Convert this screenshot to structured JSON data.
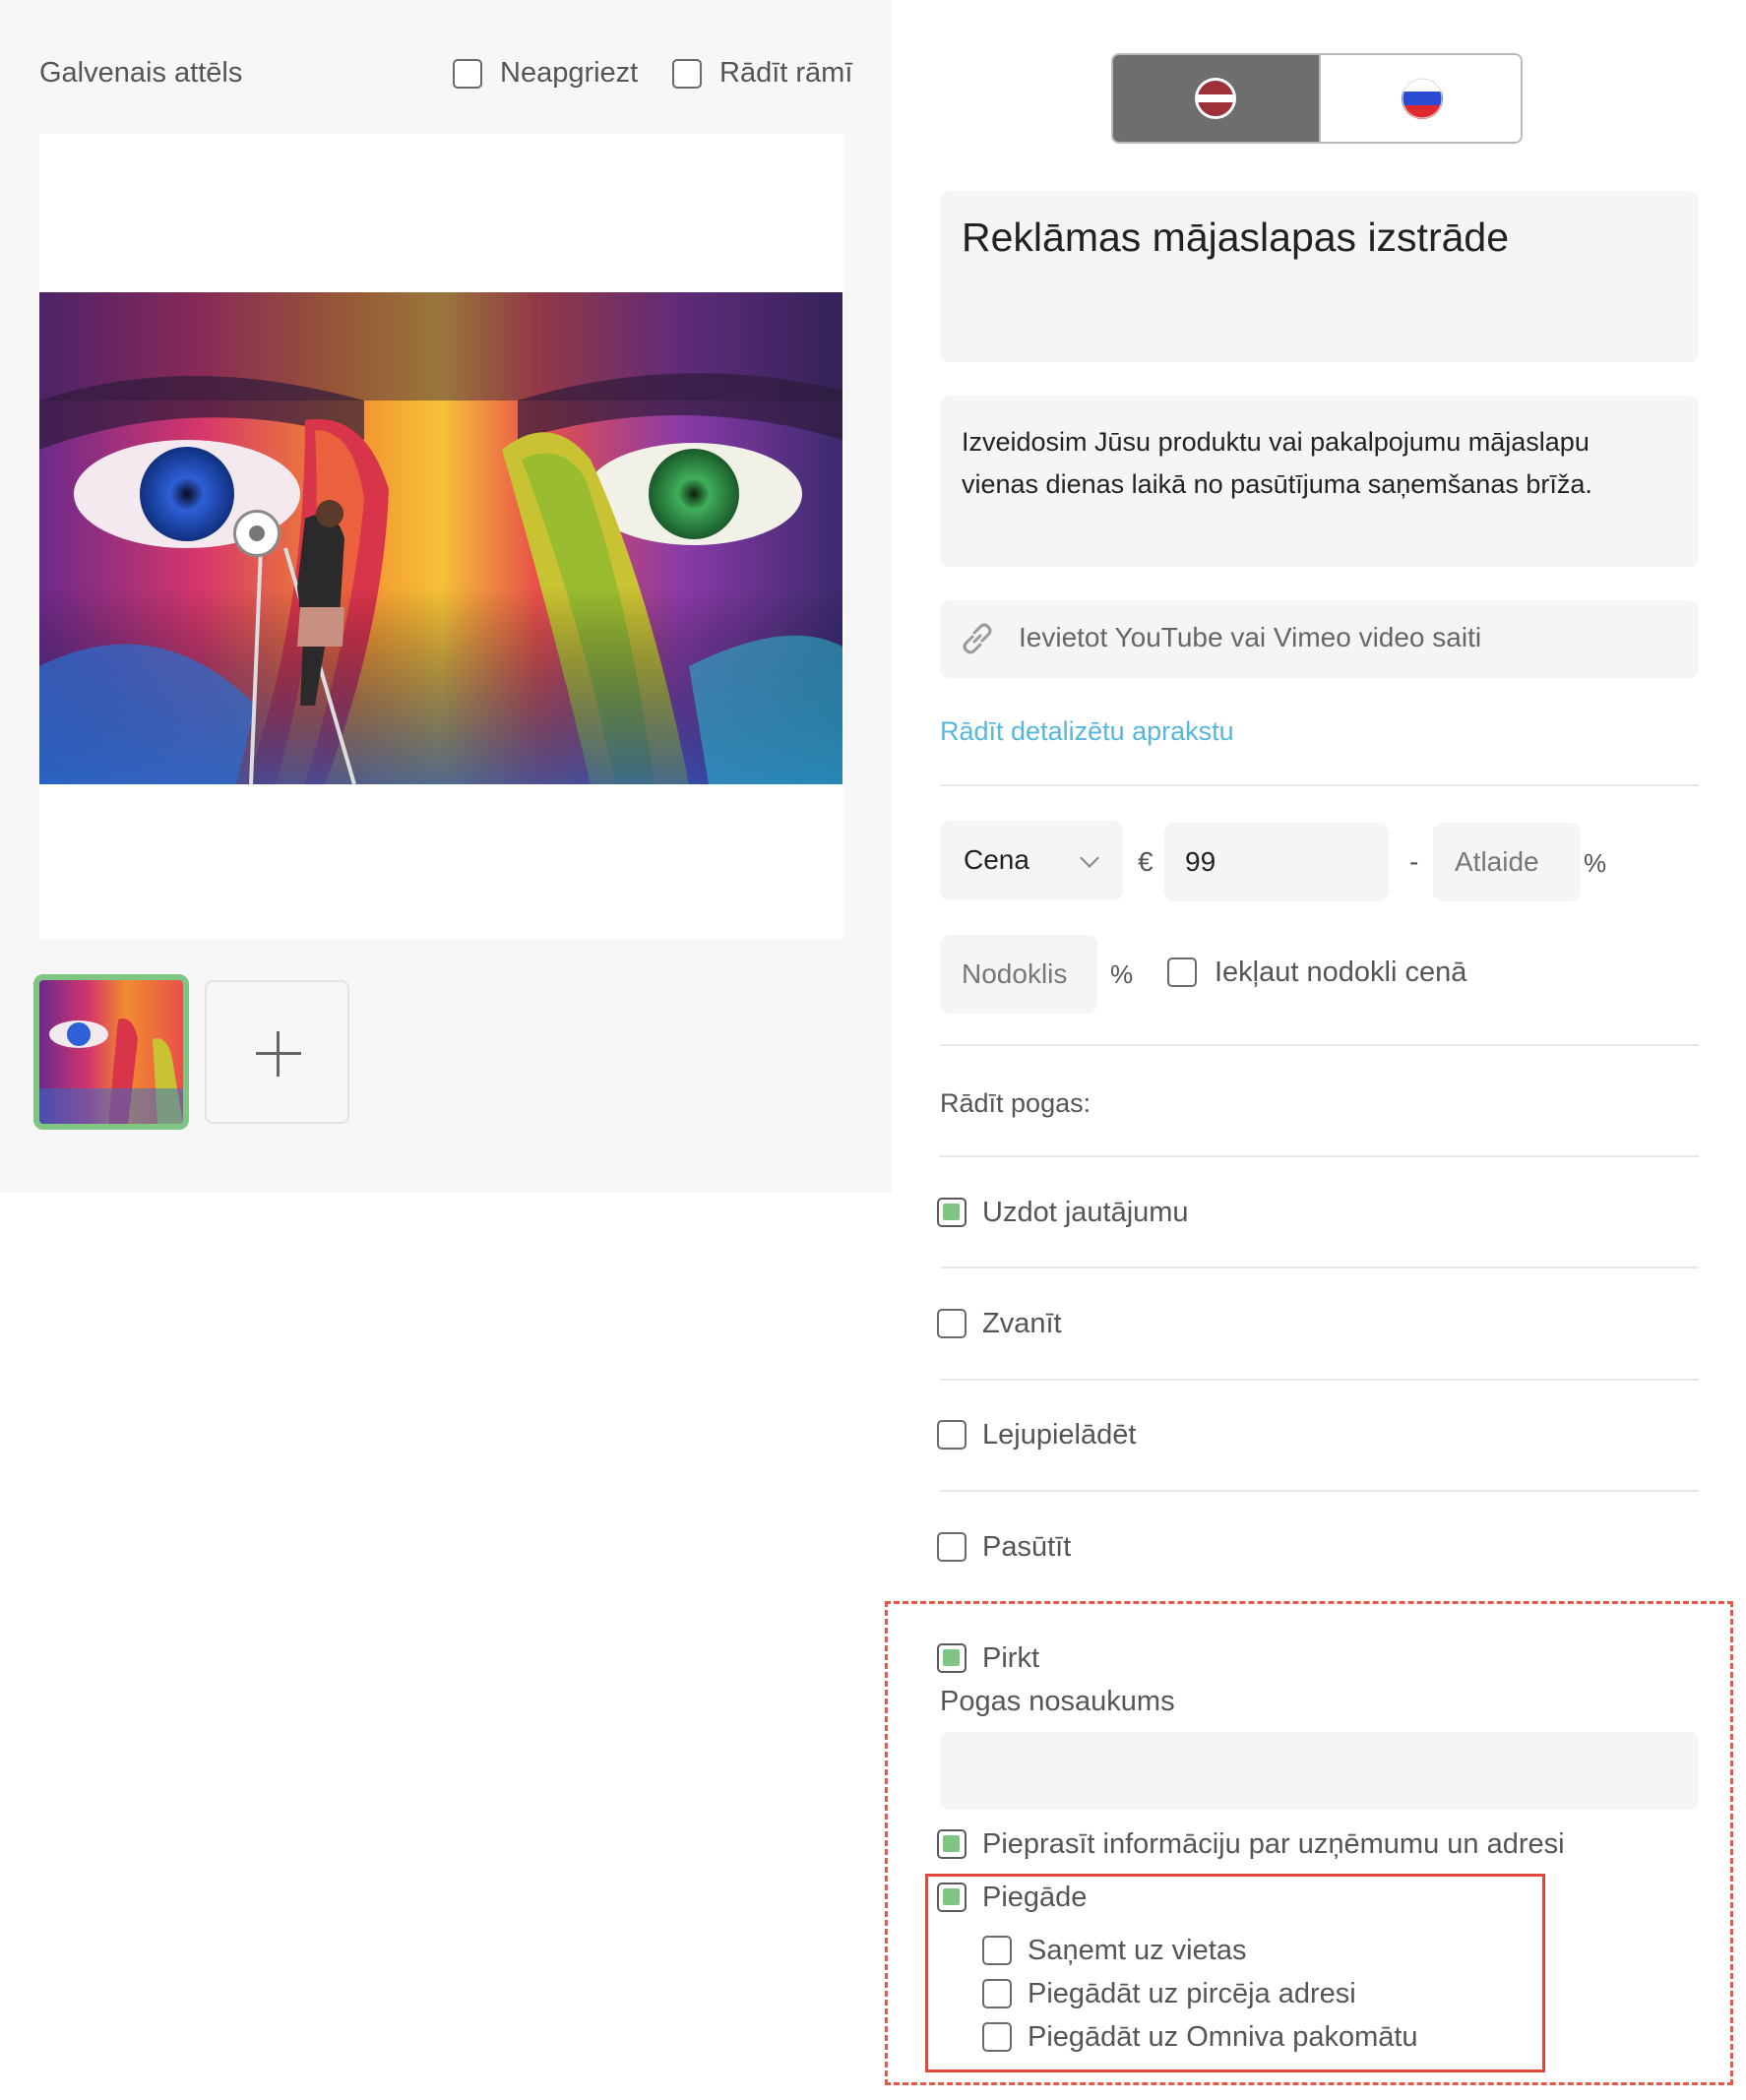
{
  "left_panel": {
    "title": "Galvenais attēls",
    "options": [
      {
        "label": "Neapgriezt",
        "checked": false
      },
      {
        "label": "Rādīt rāmī",
        "checked": false
      }
    ],
    "add_icon": "plus-icon"
  },
  "language_switch": {
    "options": [
      {
        "code": "lv",
        "active": true,
        "flag": "latvia-flag-icon"
      },
      {
        "code": "ru",
        "active": false,
        "flag": "russia-flag-icon"
      }
    ]
  },
  "product": {
    "title": "Reklāmas mājaslapas izstrāde",
    "description": "Izveidosim Jūsu produktu vai pakalpojumu mājaslapu vienas dienas laikā no pasūtījuma saņemšanas brīža.",
    "video_placeholder": "Ievietot YouTube vai Vimeo video saiti",
    "detail_link": "Rādīt detalizētu aprakstu"
  },
  "pricing": {
    "price_type": "Cena",
    "currency": "€",
    "price": "99",
    "separator": "-",
    "discount_placeholder": "Atlaide",
    "percent": "%",
    "tax_placeholder": "Nodoklis",
    "include_tax_label": "Iekļaut nodokli cenā",
    "include_tax_checked": false
  },
  "buttons_section": {
    "label": "Rādīt pogas:",
    "items": [
      {
        "label": "Uzdot jautājumu",
        "checked": true
      },
      {
        "label": "Zvanīt",
        "checked": false
      },
      {
        "label": "Lejupielādēt",
        "checked": false
      },
      {
        "label": "Pasūtīt",
        "checked": false
      }
    ]
  },
  "buy_section": {
    "buy_label": "Pirkt",
    "buy_checked": true,
    "button_name_label": "Pogas nosaukums",
    "button_name_value": "",
    "request_info_label": "Pieprasīt informāciju par uzņēmumu un adresi",
    "request_info_checked": true,
    "delivery_label": "Piegāde",
    "delivery_checked": true,
    "delivery_options": [
      {
        "label": "Saņemt uz vietas",
        "checked": false
      },
      {
        "label": "Piegādāt uz pircēja adresi",
        "checked": false
      },
      {
        "label": "Piegādāt uz Omniva pakomātu",
        "checked": false
      }
    ]
  },
  "colors": {
    "accent_green": "#7ec681",
    "link_blue": "#56b6db",
    "highlight_red": "#e04a3c"
  }
}
